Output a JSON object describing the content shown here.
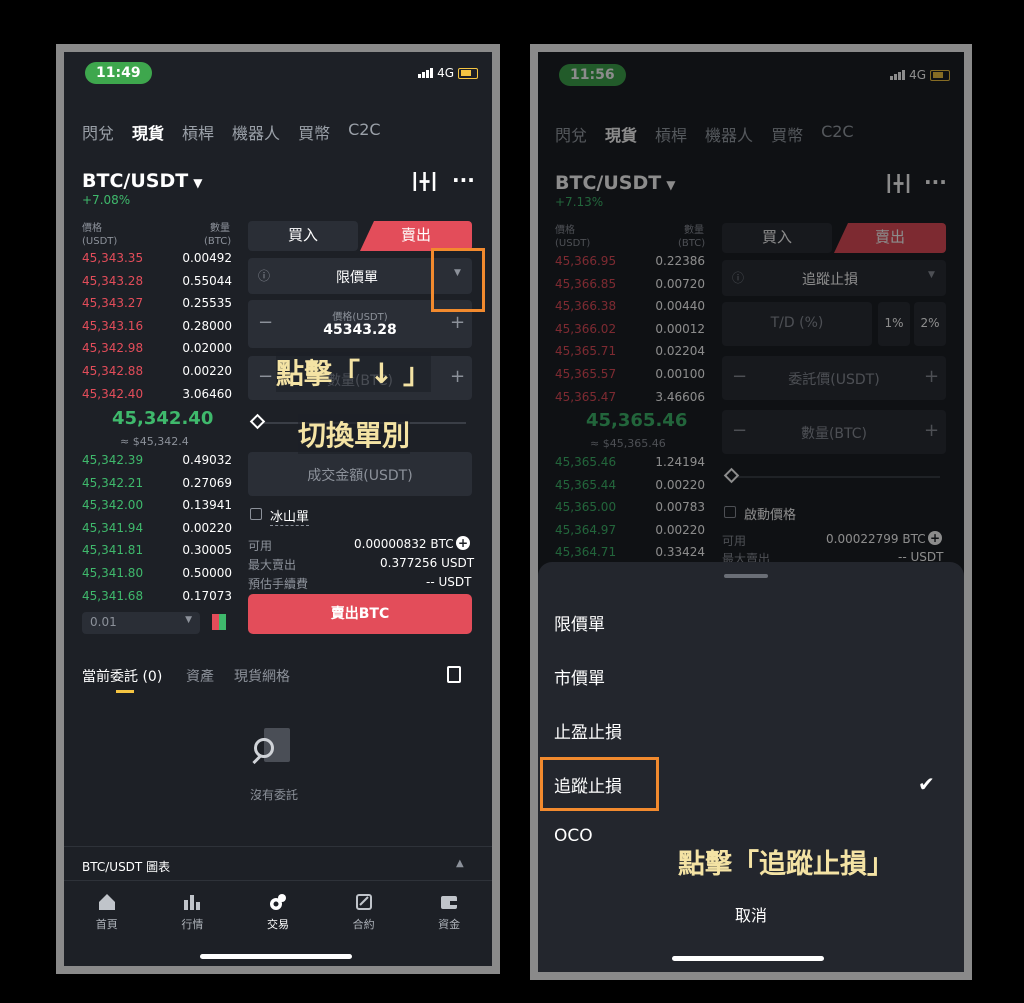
{
  "left": {
    "time": "11:49",
    "network": "4G",
    "nav": [
      "閃兌",
      "現貨",
      "槓桿",
      "機器人",
      "買幣",
      "C2C"
    ],
    "pair": "BTC/USDT",
    "change": "+7.08%",
    "price_hdr": "價格",
    "price_unit": "(USDT)",
    "qty_hdr": "數量",
    "qty_unit": "(BTC)",
    "asks": [
      [
        "45,343.35",
        "0.00492"
      ],
      [
        "45,343.28",
        "0.55044"
      ],
      [
        "45,343.27",
        "0.25535"
      ],
      [
        "45,343.16",
        "0.28000"
      ],
      [
        "45,342.98",
        "0.02000"
      ],
      [
        "45,342.88",
        "0.00220"
      ],
      [
        "45,342.40",
        "3.06460"
      ]
    ],
    "last": "45,342.40",
    "last_usd": "≈ $45,342.4",
    "bids": [
      [
        "45,342.39",
        "0.49032"
      ],
      [
        "45,342.21",
        "0.27069"
      ],
      [
        "45,342.00",
        "0.13941"
      ],
      [
        "45,341.94",
        "0.00220"
      ],
      [
        "45,341.81",
        "0.30005"
      ],
      [
        "45,341.80",
        "0.50000"
      ],
      [
        "45,341.68",
        "0.17073"
      ]
    ],
    "depth": "0.01",
    "buy": "買入",
    "sell": "賣出",
    "order_type": "限價單",
    "price_label": "價格(USDT)",
    "price_val": "45343.28",
    "qty_placeholder": "數量(BTC)",
    "total_placeholder": "成交金額(USDT)",
    "iceberg": "冰山單",
    "avail_l": "可用",
    "avail_v": "0.00000832 BTC",
    "max_l": "最大賣出",
    "max_v": "0.377256 USDT",
    "fee_l": "預估手續費",
    "fee_v": "-- USDT",
    "submit": "賣出BTC",
    "tab_orders": "當前委託 (0)",
    "tab_assets": "資產",
    "tab_grid": "現貨網格",
    "empty": "沒有委託",
    "chart_bar": "BTC/USDT 圖表",
    "footer": [
      "首頁",
      "行情",
      "交易",
      "合約",
      "資金"
    ],
    "note1": "點擊「 ↓ 」",
    "note2": "切換單別"
  },
  "right": {
    "time": "11:56",
    "network": "4G",
    "nav": [
      "閃兌",
      "現貨",
      "槓桿",
      "機器人",
      "買幣",
      "C2C"
    ],
    "pair": "BTC/USDT",
    "change": "+7.13%",
    "price_hdr": "價格",
    "price_unit": "(USDT)",
    "qty_hdr": "數量",
    "qty_unit": "(BTC)",
    "asks": [
      [
        "45,366.95",
        "0.22386"
      ],
      [
        "45,366.85",
        "0.00720"
      ],
      [
        "45,366.38",
        "0.00440"
      ],
      [
        "45,366.02",
        "0.00012"
      ],
      [
        "45,365.71",
        "0.02204"
      ],
      [
        "45,365.57",
        "0.00100"
      ],
      [
        "45,365.47",
        "3.46606"
      ]
    ],
    "last": "45,365.46",
    "last_usd": "≈ $45,365.46",
    "bids": [
      [
        "45,365.46",
        "1.24194"
      ],
      [
        "45,365.44",
        "0.00220"
      ],
      [
        "45,365.00",
        "0.00783"
      ],
      [
        "45,364.97",
        "0.00220"
      ],
      [
        "45,364.71",
        "0.33424"
      ]
    ],
    "buy": "買入",
    "sell": "賣出",
    "order_type": "追蹤止損",
    "td": "T/D (%)",
    "pct1": "1%",
    "pct2": "2%",
    "trigger": "委託價(USDT)",
    "qty": "數量(BTC)",
    "activate": "啟動價格",
    "avail_l": "可用",
    "avail_v": "0.00022799 BTC",
    "max_l": "最大賣出",
    "max_v": "-- USDT",
    "options": [
      "限價單",
      "市價單",
      "止盈止損",
      "追蹤止損",
      "OCO"
    ],
    "cancel": "取消",
    "note": "點擊「追蹤止損」"
  },
  "colors": {
    "accent": "#f28a2e",
    "sell": "#e34d5a",
    "buy": "#3fb96c",
    "note": "#f4e3a4"
  }
}
